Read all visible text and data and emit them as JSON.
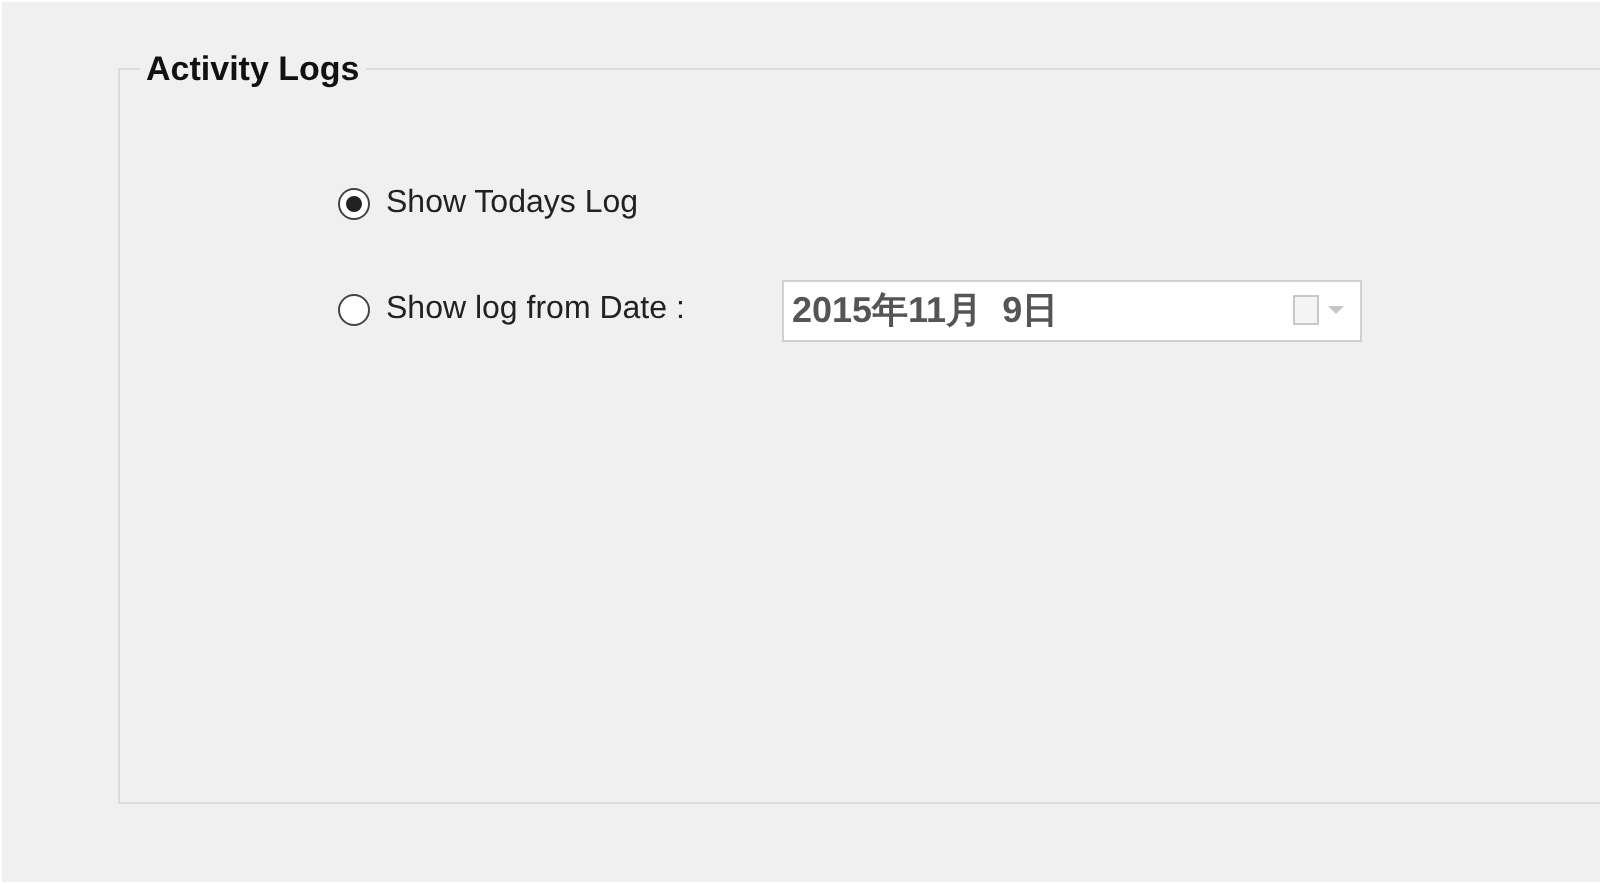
{
  "group": {
    "title": "Activity Logs"
  },
  "options": [
    {
      "label": "Show Todays Log",
      "selected": true
    },
    {
      "label": "Show log from Date :",
      "selected": false
    }
  ],
  "date_picker": {
    "value": "2015年11月  9日",
    "disabled": true
  }
}
